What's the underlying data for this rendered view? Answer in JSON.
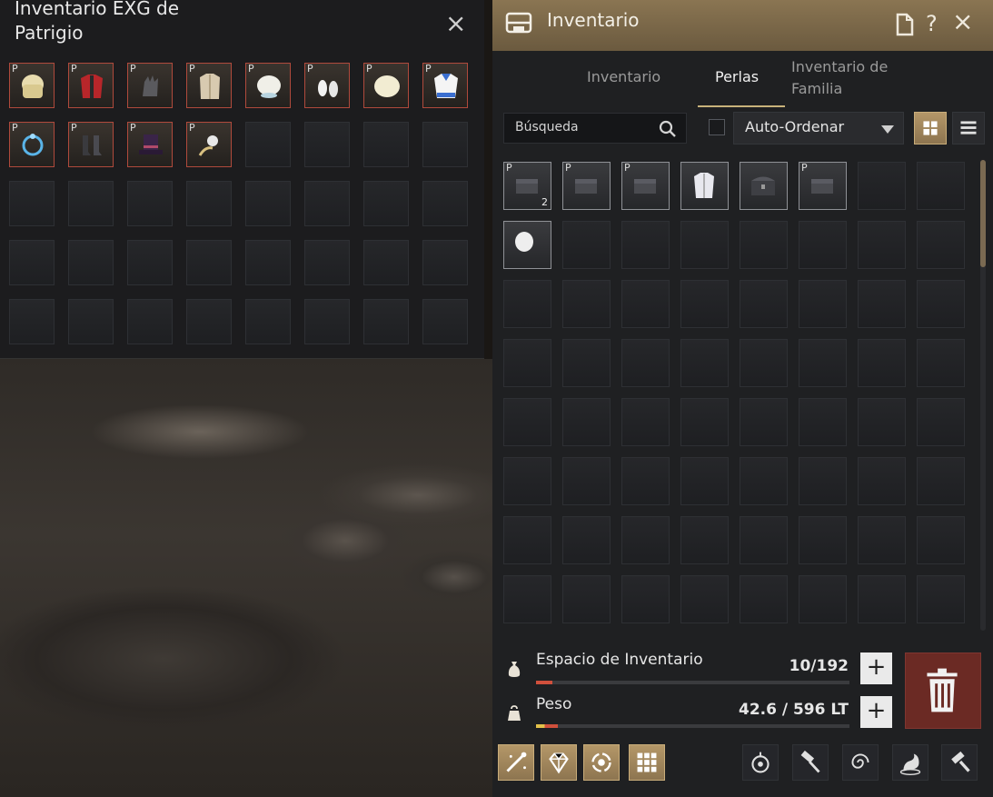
{
  "left_window": {
    "title": "Inventario EXG de Patrigio",
    "close_symbol": "×",
    "slots_per_row": 8,
    "rows": 5,
    "items": [
      {
        "icon": "blonde-hair-icon",
        "tag": "P"
      },
      {
        "icon": "red-jacket-icon",
        "tag": "P"
      },
      {
        "icon": "gloves-icon",
        "tag": "P"
      },
      {
        "icon": "coat-icon",
        "tag": "P"
      },
      {
        "icon": "hair-white-icon",
        "tag": "P"
      },
      {
        "icon": "shoes-icon",
        "tag": "P"
      },
      {
        "icon": "cream-hair-icon",
        "tag": "P"
      },
      {
        "icon": "sailor-shirt-icon",
        "tag": "P"
      },
      {
        "icon": "blue-ring-icon",
        "tag": "P"
      },
      {
        "icon": "boots-icon",
        "tag": "P"
      },
      {
        "icon": "top-hat-icon",
        "tag": "P"
      },
      {
        "icon": "accessory-icon",
        "tag": "P"
      }
    ]
  },
  "right_window": {
    "title": "Inventario",
    "header_buttons": [
      "document-icon",
      "help-icon",
      "close-icon"
    ],
    "help_symbol": "?",
    "close_symbol": "×",
    "tabs": [
      {
        "label": "Inventario",
        "active": false
      },
      {
        "label": "Perlas",
        "active": true
      },
      {
        "label": "Inventario de Familia",
        "active": false
      }
    ],
    "search": {
      "placeholder": "Búsqueda"
    },
    "sort": {
      "label": "Auto-Ordenar",
      "checked": false
    },
    "grid": {
      "columns": 8,
      "rows": 8,
      "items": [
        {
          "tag": "P",
          "qty": "2",
          "icon": "pearl-box-icon"
        },
        {
          "tag": "P",
          "qty": "",
          "icon": "pearl-box-icon"
        },
        {
          "tag": "P",
          "qty": "",
          "icon": "pearl-box-icon"
        },
        {
          "tag": "",
          "qty": "",
          "icon": "outfit-icon"
        },
        {
          "tag": "",
          "qty": "",
          "icon": "chest-icon"
        },
        {
          "tag": "P",
          "qty": "",
          "icon": "pearl-box-icon"
        },
        null,
        null,
        {
          "tag": "",
          "qty": "",
          "icon": "hair-item-icon"
        }
      ]
    },
    "space": {
      "label": "Espacio de Inventario",
      "value": "10/192",
      "fill": 0.052
    },
    "weight": {
      "label": "Peso",
      "value": "42.6 / 596 LT",
      "fill": 0.071
    },
    "plus_symbol": "+",
    "bottom_buttons_left": [
      "wand-icon",
      "gem-icon",
      "swirl-icon",
      "grid-icon"
    ],
    "bottom_buttons_right": [
      "lantern-icon",
      "hammer-icon",
      "spiral-icon",
      "dragon-icon",
      "anvil-icon"
    ],
    "colors": {
      "header_gold": "#8a7552",
      "accent_gold": "#c8b27a",
      "space_fill": "#d0503c",
      "weight_fill": "#e3c14a",
      "trash_red": "#6b2a24"
    }
  }
}
